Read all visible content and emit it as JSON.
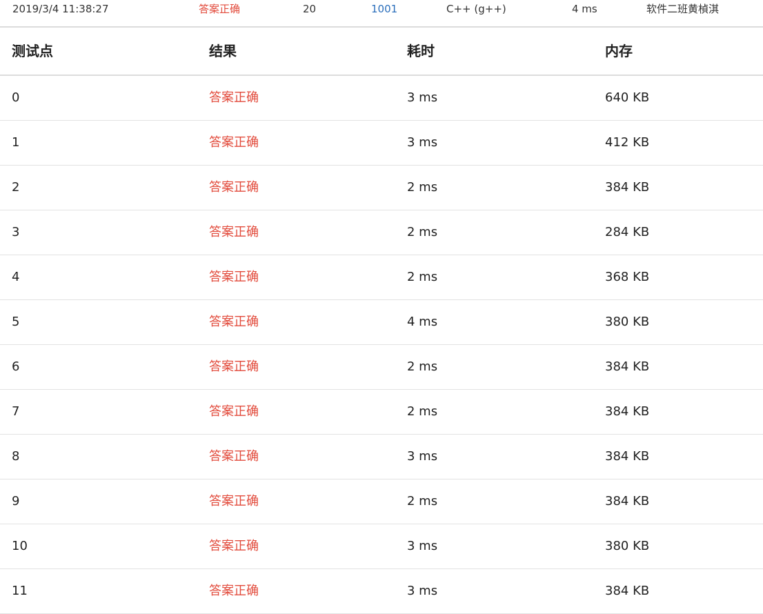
{
  "submission": {
    "submit_time": "2019/3/4 11:38:27",
    "status": "答案正确",
    "score": "20",
    "problem": "1001",
    "language": "C++ (g++)",
    "run_time": "4 ms",
    "user": "软件二班黄楨淇"
  },
  "table": {
    "headers": [
      "测试点",
      "结果",
      "耗时",
      "内存"
    ],
    "rows": [
      {
        "case": "0",
        "result": "答案正确",
        "time": "3 ms",
        "memory": "640 KB"
      },
      {
        "case": "1",
        "result": "答案正确",
        "time": "3 ms",
        "memory": "412 KB"
      },
      {
        "case": "2",
        "result": "答案正确",
        "time": "2 ms",
        "memory": "384 KB"
      },
      {
        "case": "3",
        "result": "答案正确",
        "time": "2 ms",
        "memory": "284 KB"
      },
      {
        "case": "4",
        "result": "答案正确",
        "time": "2 ms",
        "memory": "368 KB"
      },
      {
        "case": "5",
        "result": "答案正确",
        "time": "4 ms",
        "memory": "380 KB"
      },
      {
        "case": "6",
        "result": "答案正确",
        "time": "2 ms",
        "memory": "384 KB"
      },
      {
        "case": "7",
        "result": "答案正确",
        "time": "2 ms",
        "memory": "384 KB"
      },
      {
        "case": "8",
        "result": "答案正确",
        "time": "3 ms",
        "memory": "384 KB"
      },
      {
        "case": "9",
        "result": "答案正确",
        "time": "2 ms",
        "memory": "384 KB"
      },
      {
        "case": "10",
        "result": "答案正确",
        "time": "3 ms",
        "memory": "380 KB"
      },
      {
        "case": "11",
        "result": "答案正确",
        "time": "3 ms",
        "memory": "384 KB"
      }
    ]
  },
  "colors": {
    "accepted": "#e24a3b",
    "link": "#2a6ebb"
  }
}
